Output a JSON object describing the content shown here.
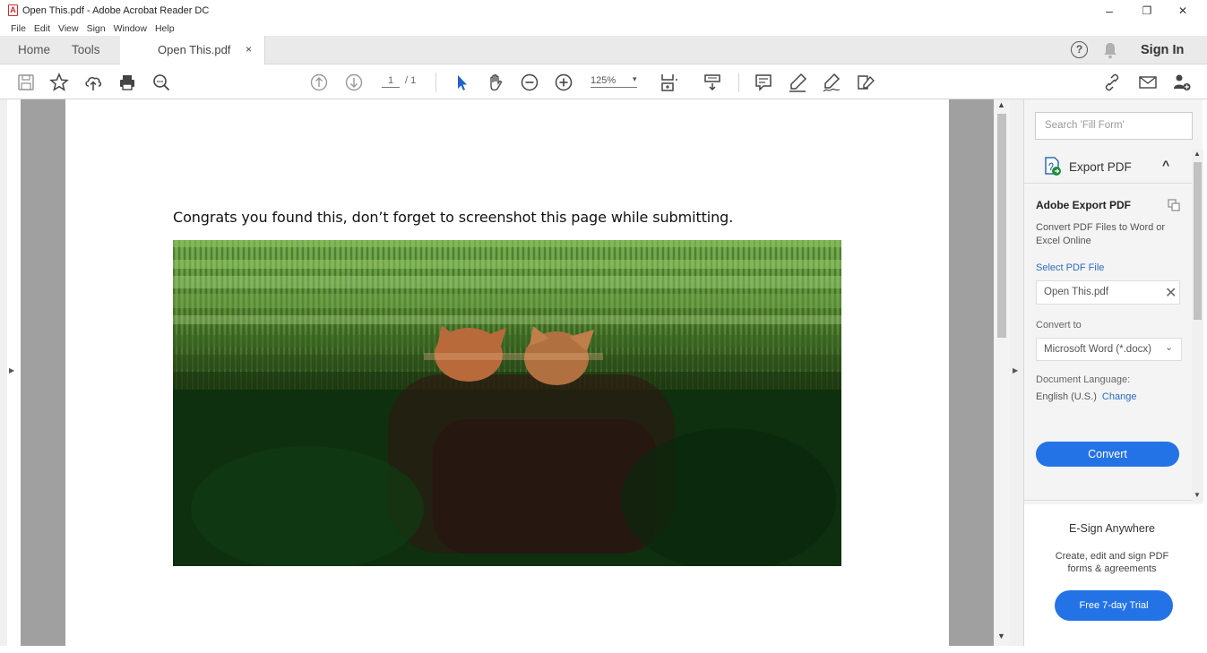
{
  "window": {
    "title": "Open This.pdf - Adobe Acrobat Reader DC",
    "minimize": "–",
    "restore": "❐",
    "close": "✕"
  },
  "menu": [
    "File",
    "Edit",
    "View",
    "Sign",
    "Window",
    "Help"
  ],
  "tabs": {
    "home": "Home",
    "tools": "Tools",
    "document": "Open This.pdf",
    "close_glyph": "×"
  },
  "header_right": {
    "help_glyph": "?",
    "sign_in": "Sign In"
  },
  "toolbar": {
    "page_current": "1",
    "page_total": "/ 1",
    "zoom": "125%",
    "zoom_caret": "▾"
  },
  "document": {
    "text": "Congrats you found this, don’t forget to screenshot this page while submitting.",
    "image_alt": "glitched photo of two cats"
  },
  "right_pane": {
    "search_placeholder": "Search 'Fill Form'",
    "export_title": "Export PDF",
    "export_caret": "^",
    "adobe_export_title": "Adobe Export PDF",
    "adobe_export_desc": "Convert PDF Files to Word or Excel Online",
    "select_label": "Select PDF File",
    "selected_file": "Open This.pdf",
    "clear_glyph": "✕",
    "convert_to_label": "Convert to",
    "convert_to_value": "Microsoft Word (*.docx)",
    "dropdown_glyph": "⌄",
    "doc_lang_label": "Document Language:",
    "doc_lang_value": "English (U.S.)",
    "doc_lang_change": "Change",
    "convert_button": "Convert",
    "esign_title": "E-Sign Anywhere",
    "esign_desc": "Create, edit and sign PDF forms & agreements",
    "trial_button": "Free 7-day Trial"
  },
  "colors": {
    "accent": "#2473e6",
    "link": "#2b6cc4",
    "gutter": "#a0a0a0"
  }
}
